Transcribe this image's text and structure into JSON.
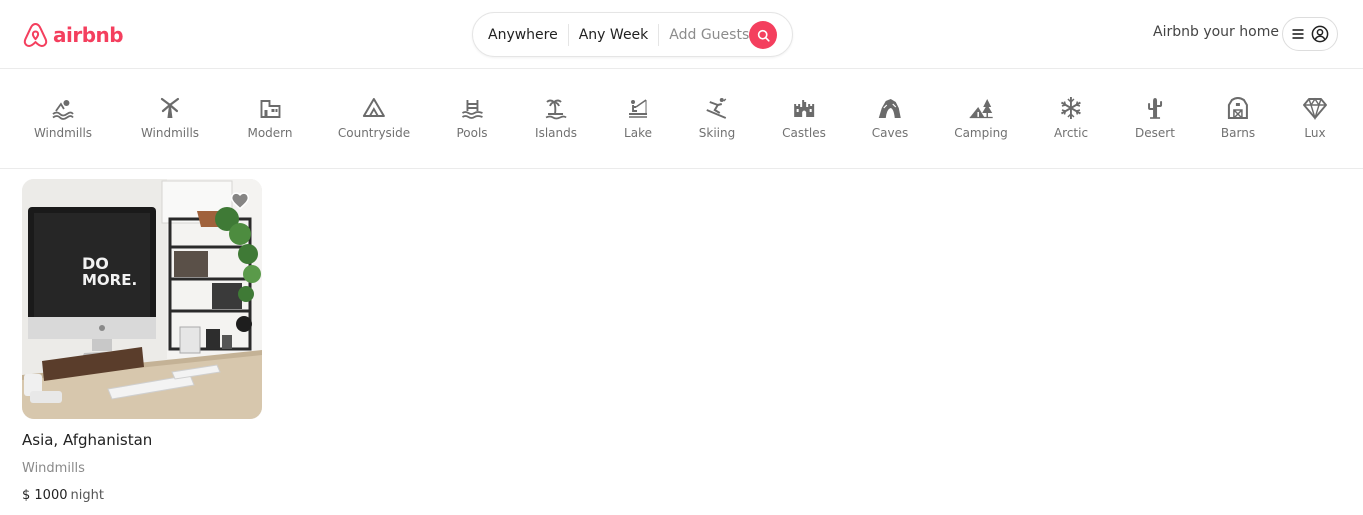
{
  "brand": {
    "name": "airbnb",
    "color": "#f43f5e"
  },
  "search": {
    "location": "Anywhere",
    "dates": "Any Week",
    "guests_placeholder": "Add Guests",
    "button_icon": "search-icon"
  },
  "header": {
    "host_link": "Airbnb your home",
    "menu_icon": "menu-icon",
    "avatar_icon": "user-circle-icon"
  },
  "categories": [
    {
      "label": "Windmills",
      "icon": "beach-icon"
    },
    {
      "label": "Windmills",
      "icon": "windmill-icon"
    },
    {
      "label": "Modern",
      "icon": "modern-building-icon"
    },
    {
      "label": "Countryside",
      "icon": "mountain-icon"
    },
    {
      "label": "Pools",
      "icon": "pool-icon"
    },
    {
      "label": "Islands",
      "icon": "island-icon"
    },
    {
      "label": "Lake",
      "icon": "lake-icon"
    },
    {
      "label": "Skiing",
      "icon": "skiing-icon"
    },
    {
      "label": "Castles",
      "icon": "castle-icon"
    },
    {
      "label": "Caves",
      "icon": "cave-icon"
    },
    {
      "label": "Camping",
      "icon": "camping-icon"
    },
    {
      "label": "Arctic",
      "icon": "snowflake-icon"
    },
    {
      "label": "Desert",
      "icon": "cactus-icon"
    },
    {
      "label": "Barns",
      "icon": "barn-icon"
    },
    {
      "label": "Lux",
      "icon": "diamond-icon"
    }
  ],
  "listings": [
    {
      "title": "Asia, Afghanistan",
      "category": "Windmills",
      "price": "$ 1000",
      "price_unit": "night",
      "image_text": [
        "DO",
        "MORE."
      ]
    }
  ]
}
